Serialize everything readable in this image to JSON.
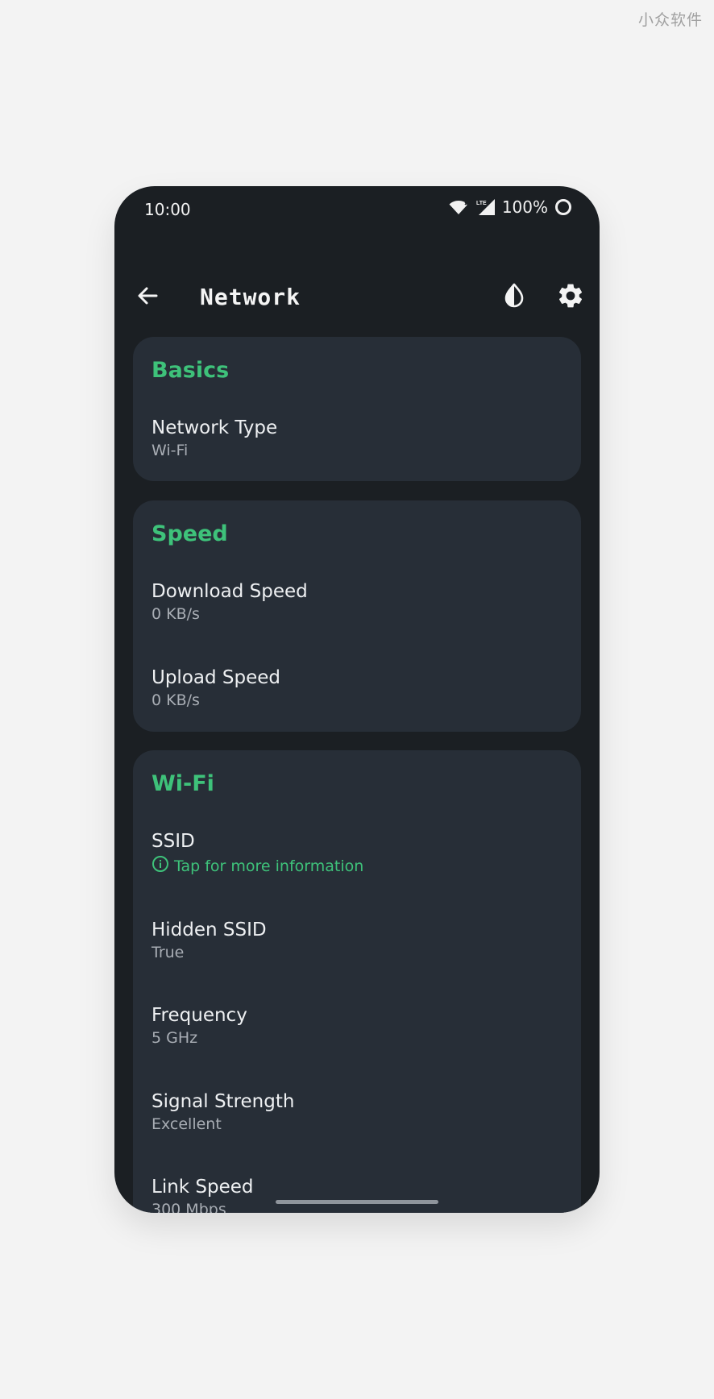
{
  "watermark": "小众软件",
  "statusbar": {
    "time": "10:00",
    "battery": "100%",
    "icons": [
      "wifi-icon",
      "lte-signal-icon",
      "battery-ring-icon"
    ]
  },
  "appbar": {
    "title": "Network",
    "icons": [
      "back-arrow-icon",
      "contrast-icon",
      "gear-icon"
    ]
  },
  "colors": {
    "accent": "#3ec27a",
    "background": "#1b1f23",
    "card": "#272e37",
    "page": "#f3f3f3"
  },
  "sections": {
    "basics": {
      "title": "Basics",
      "items": [
        {
          "label": "Network Type",
          "value": "Wi-Fi"
        }
      ]
    },
    "speed": {
      "title": "Speed",
      "items": [
        {
          "label": "Download Speed",
          "value": "0 KB/s"
        },
        {
          "label": "Upload Speed",
          "value": "0 KB/s"
        }
      ]
    },
    "wifi": {
      "title": "Wi-Fi",
      "items": [
        {
          "label": "SSID",
          "info": "Tap for more information"
        },
        {
          "label": "Hidden SSID",
          "value": "True"
        },
        {
          "label": "Frequency",
          "value": "5 GHz"
        },
        {
          "label": "Signal Strength",
          "value": "Excellent"
        },
        {
          "label": "Link Speed",
          "value": "300 Mbps"
        }
      ]
    }
  }
}
